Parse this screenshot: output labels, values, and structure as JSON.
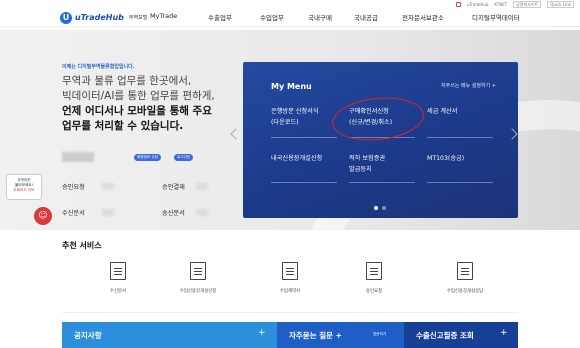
{
  "utility": {
    "links": [
      "uTradeHub",
      "KTNET",
      "공정위사이트",
      "Quick Link"
    ]
  },
  "header": {
    "logo_name": "uTradeHub",
    "logo_sub": "무역포털",
    "nav": [
      "MyTrade",
      "수출업무",
      "수입업무",
      "국내구매",
      "국내공급",
      "전자문서보관소",
      "디지털무역데이터"
    ]
  },
  "hero": {
    "tagline": "이제는 디지털무역물류협업입니다.",
    "line1": "무역과 물류 업무를 한곳에서,",
    "line2": "빅데이터/AI를 통한 업무를 편하게,",
    "line3": "언제 어디서나 모바일을 통해 주요",
    "line4": "업무를 처리할 수 있습니다.",
    "buttons": [
      "회원정보 수정",
      "로그아웃"
    ],
    "quick": [
      {
        "left": "승인요청",
        "right": "승인결재"
      },
      {
        "left": "수신문서",
        "right": "송신문서"
      }
    ]
  },
  "side": {
    "badge_line1": "무엇이든",
    "badge_line2": "물어보세요!",
    "badge_line3": "트레이드 티브"
  },
  "mymenu": {
    "title": "My Menu",
    "edit": "자주쓰는 메뉴 설정하기 +",
    "items": [
      {
        "line1": "은행방문 신청서식",
        "line2": "(다운로드)"
      },
      {
        "line1": "구매확인서신청",
        "line2": "(신규/변경/취소)"
      },
      {
        "line1": "세금 계산서",
        "line2": ""
      },
      {
        "line1": "내국신용장개설신청",
        "line2": ""
      },
      {
        "line1": "적하 보험증권",
        "line2": "발급등지"
      },
      {
        "line1": "MT103(송금)",
        "line2": ""
      }
    ]
  },
  "recommended": {
    "title": "추천 서비스",
    "items": [
      "수신문서",
      "수입신용장개설신청",
      "수입계약서",
      "승인요청",
      "수입신용장개설응답"
    ]
  },
  "bottom": {
    "notice": "공지사항",
    "faq": "자주묻는 질문 +",
    "faq_small": "접문하기",
    "export": "수출신고필증 조회",
    "plus": "+"
  }
}
